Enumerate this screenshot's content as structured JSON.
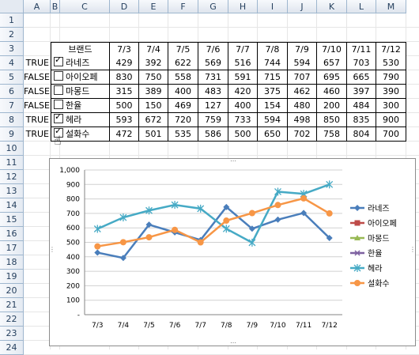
{
  "columns": [
    "A",
    "B",
    "C",
    "D",
    "E",
    "F",
    "G",
    "H",
    "I",
    "J",
    "K",
    "L",
    "M"
  ],
  "rows": [
    "1",
    "2",
    "3",
    "4",
    "5",
    "6",
    "7",
    "8",
    "9",
    "10",
    "11",
    "12",
    "13",
    "14",
    "15",
    "16",
    "17",
    "18",
    "19",
    "20",
    "21",
    "22",
    "23",
    "24"
  ],
  "table": {
    "brand_header": "브랜드",
    "dates": [
      "7/3",
      "7/4",
      "7/5",
      "7/6",
      "7/7",
      "7/8",
      "7/9",
      "7/10",
      "7/11",
      "7/12"
    ],
    "rows": [
      {
        "flag": "TRUE",
        "checked": true,
        "name": "라네즈",
        "values": [
          429,
          392,
          622,
          569,
          516,
          744,
          594,
          657,
          703,
          530
        ]
      },
      {
        "flag": "FALSE",
        "checked": false,
        "name": "아이오페",
        "values": [
          830,
          750,
          558,
          731,
          591,
          715,
          707,
          695,
          665,
          790
        ]
      },
      {
        "flag": "FALSE",
        "checked": false,
        "name": "마몽드",
        "values": [
          315,
          389,
          400,
          483,
          420,
          375,
          462,
          460,
          397,
          390
        ]
      },
      {
        "flag": "FALSE",
        "checked": false,
        "name": "한율",
        "values": [
          500,
          150,
          469,
          127,
          400,
          154,
          480,
          200,
          484,
          300
        ]
      },
      {
        "flag": "TRUE",
        "checked": true,
        "name": "헤라",
        "values": [
          593,
          672,
          720,
          759,
          733,
          594,
          498,
          850,
          835,
          900
        ]
      },
      {
        "flag": "TRUE",
        "checked": true,
        "name": "설화수",
        "values": [
          472,
          501,
          535,
          586,
          500,
          650,
          702,
          758,
          804,
          700
        ]
      }
    ]
  },
  "chart_data": {
    "type": "line",
    "categories": [
      "7/3",
      "7/4",
      "7/5",
      "7/6",
      "7/7",
      "7/8",
      "7/9",
      "7/10",
      "7/11",
      "7/12"
    ],
    "ylim": [
      0,
      1000
    ],
    "yticks": [
      "-",
      "100",
      "200",
      "300",
      "400",
      "500",
      "600",
      "700",
      "800",
      "900",
      "1,000"
    ],
    "grid": true,
    "legend_position": "right",
    "series": [
      {
        "name": "라네즈",
        "color": "#4a7ebb",
        "marker": "diamond",
        "visible": true,
        "values": [
          429,
          392,
          622,
          569,
          516,
          744,
          594,
          657,
          703,
          530
        ]
      },
      {
        "name": "아이오페",
        "color": "#be4b48",
        "marker": "square",
        "visible": false,
        "values": []
      },
      {
        "name": "마몽드",
        "color": "#98b954",
        "marker": "triangle",
        "visible": false,
        "values": []
      },
      {
        "name": "한율",
        "color": "#7d60a0",
        "marker": "x",
        "visible": false,
        "values": []
      },
      {
        "name": "헤라",
        "color": "#46aac5",
        "marker": "star",
        "visible": true,
        "values": [
          593,
          672,
          720,
          759,
          733,
          594,
          498,
          850,
          835,
          900
        ]
      },
      {
        "name": "설화수",
        "color": "#f79646",
        "marker": "circle",
        "visible": true,
        "values": [
          472,
          501,
          535,
          586,
          500,
          650,
          702,
          758,
          804,
          700
        ]
      }
    ]
  }
}
